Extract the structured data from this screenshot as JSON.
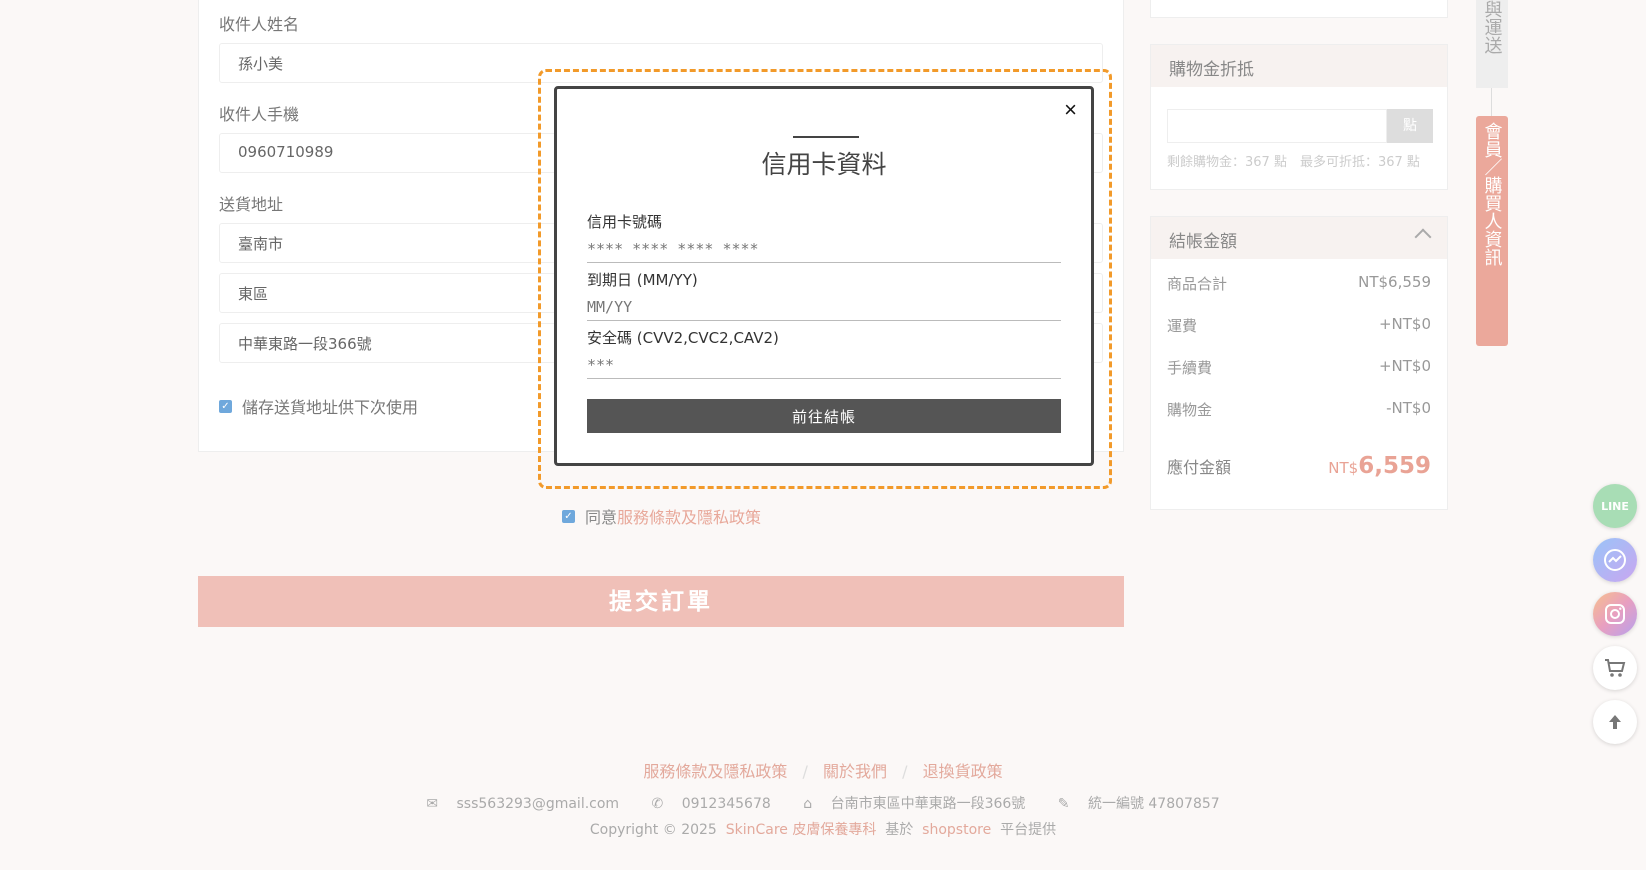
{
  "form": {
    "name_label": "收件人姓名",
    "name_value": "孫小美",
    "phone_label": "收件人手機",
    "phone_value": "0960710989",
    "address_label": "送貨地址",
    "city_value": "臺南市",
    "district_value": "東區",
    "street_value": "中華東路一段366號",
    "save_address_label": "儲存送貨地址供下次使用"
  },
  "agree": {
    "prefix": "同意",
    "link": "服務條款及隱私政策"
  },
  "submit_label": "提交訂單",
  "discount": {
    "title": "購物金折抵",
    "button": "點",
    "note": "剩餘購物金：367 點　最多可折抵：367 點"
  },
  "summary": {
    "title": "結帳金額",
    "rows": [
      {
        "label": "商品合計",
        "value": "NT$6,559"
      },
      {
        "label": "運費",
        "value": "+NT$0"
      },
      {
        "label": "手續費",
        "value": "+NT$0"
      },
      {
        "label": "購物金",
        "value": "-NT$0"
      }
    ],
    "total_label": "應付金額",
    "total_currency": "NT$",
    "total_amount": "6,559"
  },
  "side_tabs": {
    "grey": "與運送",
    "pink": "會員／購買人資訊"
  },
  "floating": {
    "line": "LINE",
    "cart_icon": "cart-icon",
    "top_icon": "arrow-up-icon"
  },
  "footer": {
    "links": [
      "服務條款及隱私政策",
      "關於我們",
      "退換貨政策"
    ],
    "email": "sss563293@gmail.com",
    "phone": "0912345678",
    "address": "台南市東區中華東路一段366號",
    "tax_id": "統一編號 47807857",
    "copy_prefix": "Copyright © 2025",
    "copy_brand": "SkinCare 皮膚保養專科",
    "copy_mid": "基於",
    "copy_platform": "shopstore",
    "copy_suffix": "平台提供"
  },
  "modal": {
    "title": "信用卡資料",
    "card_label": "信用卡號碼",
    "card_placeholder": "**** **** **** ****",
    "expiry_label": "到期日 (MM/YY)",
    "expiry_placeholder": "MM/YY",
    "cvv_label": "安全碼 (CVV2,CVC2,CAV2)",
    "cvv_placeholder": "***",
    "submit_label": "前往結帳",
    "close": "×"
  },
  "colors": {
    "accent": "#eba89b",
    "submit": "#f0c0b8",
    "highlight": "#f29a2a",
    "modal_button": "#555555"
  }
}
